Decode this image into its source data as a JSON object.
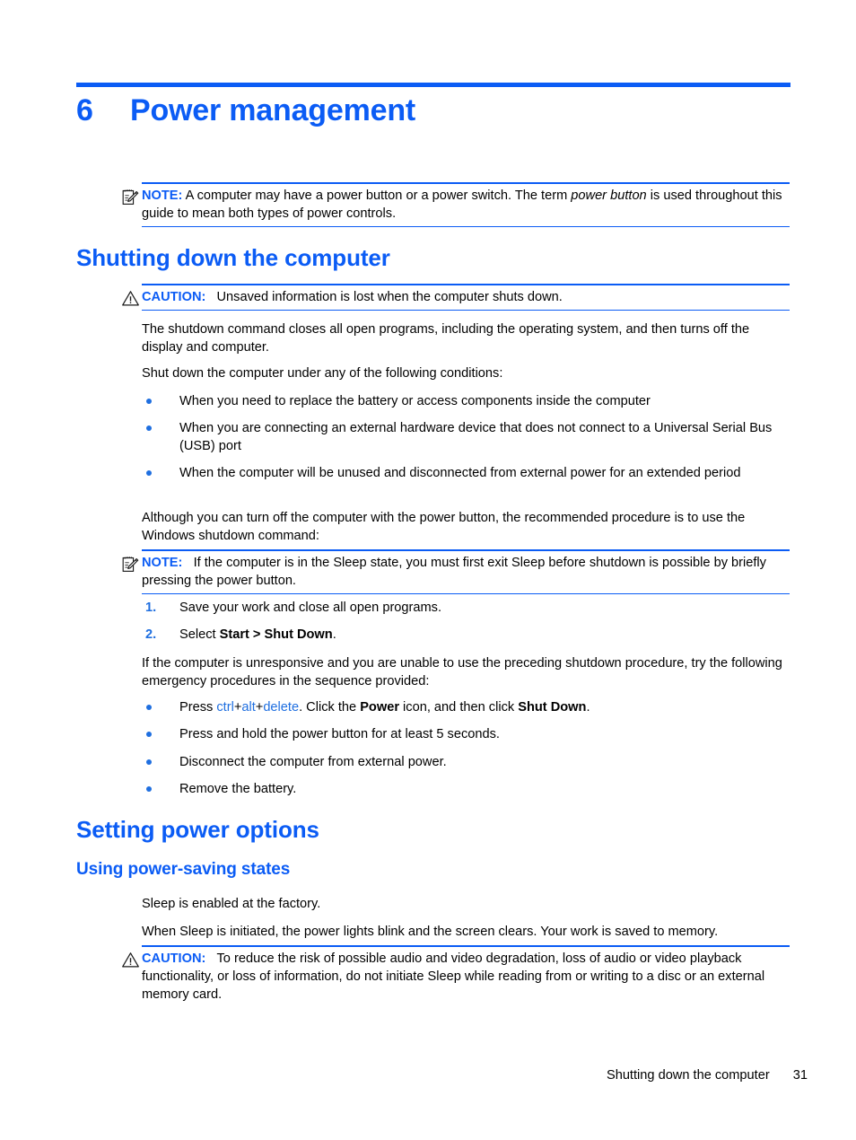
{
  "document": {
    "chapter_number": "6",
    "chapter_title": "Power management",
    "accent_color": "#0b5cf5",
    "text_color": "#000000",
    "page_background": "#ffffff"
  },
  "note_top": {
    "icon": "note-pad-pencil-icon",
    "label": "NOTE:",
    "text_before_italic": "A computer may have a power button or a power switch. The term ",
    "italic_term": "power button",
    "text_after_italic": " is used throughout this guide to mean both types of power controls."
  },
  "section_shutdown": {
    "heading": "Shutting down the computer",
    "caution": {
      "icon": "warning-triangle-icon",
      "label": "CAUTION:",
      "text": "Unsaved information is lost when the computer shuts down."
    },
    "para_1": "The shutdown command closes all open programs, including the operating system, and then turns off the display and computer.",
    "para_2": "Shut down the computer under any of the following conditions:",
    "conditions": [
      "When you need to replace the battery or access components inside the computer",
      "When you are connecting an external hardware device that does not connect to a Universal Serial Bus (USB) port",
      "When the computer will be unused and disconnected from external power for an extended period"
    ],
    "para_3": "Although you can turn off the computer with the power button, the recommended procedure is to use the Windows shutdown command:",
    "note": {
      "icon": "note-pad-pencil-icon",
      "label": "NOTE:",
      "text": "If the computer is in the Sleep state, you must first exit Sleep before shutdown is possible by briefly pressing the power button."
    },
    "steps": [
      {
        "marker": "1.",
        "text": "Save your work and close all open programs."
      },
      {
        "marker": "2.",
        "text_prefix": "Select ",
        "bold": "Start > Shut Down",
        "text_suffix": "."
      }
    ],
    "para_4": "If the computer is unresponsive and you are unable to use the preceding shutdown procedure, try the following emergency procedures in the sequence provided:",
    "emergency": [
      {
        "segments": [
          {
            "text": "Press ",
            "style": "normal"
          },
          {
            "text": "ctrl",
            "style": "key"
          },
          {
            "text": "+",
            "style": "normal"
          },
          {
            "text": "alt",
            "style": "key"
          },
          {
            "text": "+",
            "style": "normal"
          },
          {
            "text": "delete",
            "style": "key"
          },
          {
            "text": ". Click the ",
            "style": "normal"
          },
          {
            "text": "Power",
            "style": "bold"
          },
          {
            "text": " icon, and then click ",
            "style": "normal"
          },
          {
            "text": "Shut Down",
            "style": "bold"
          },
          {
            "text": ".",
            "style": "normal"
          }
        ]
      },
      {
        "text": "Press and hold the power button for at least 5 seconds."
      },
      {
        "text": "Disconnect the computer from external power."
      },
      {
        "text": "Remove the battery."
      }
    ]
  },
  "section_power_options": {
    "heading": "Setting power options",
    "subheading": "Using power-saving states",
    "para_1": "Sleep is enabled at the factory.",
    "para_2": "When Sleep is initiated, the power lights blink and the screen clears. Your work is saved to memory.",
    "caution": {
      "icon": "warning-triangle-icon",
      "label": "CAUTION:",
      "text": "To reduce the risk of possible audio and video degradation, loss of audio or video playback functionality, or loss of information, do not initiate Sleep while reading from or writing to a disc or an external memory card."
    }
  },
  "footer": {
    "title": "Shutting down the computer",
    "page_number": "31"
  }
}
